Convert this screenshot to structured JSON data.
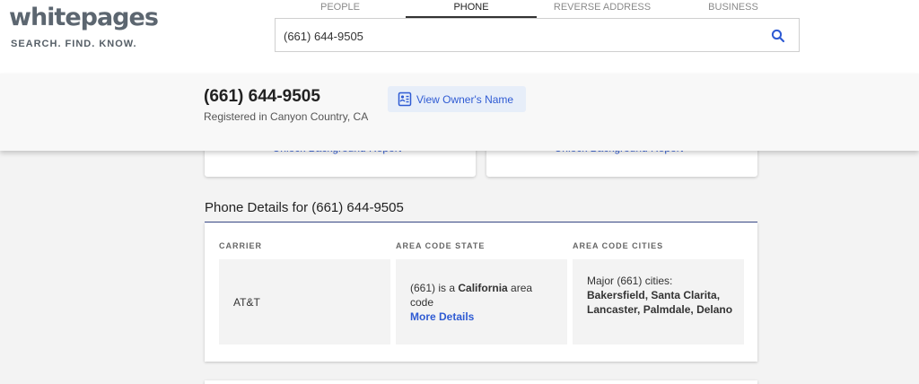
{
  "brand": {
    "name": "whitepages",
    "tagline": "SEARCH. FIND. KNOW."
  },
  "nav_tabs": [
    {
      "label": "PEOPLE",
      "active": false
    },
    {
      "label": "PHONE",
      "active": true
    },
    {
      "label": "REVERSE ADDRESS",
      "active": false
    },
    {
      "label": "BUSINESS",
      "active": false
    }
  ],
  "search": {
    "value": "(661) 644-9505",
    "icon": "search-icon"
  },
  "sticky": {
    "phone": "(661) 644-9505",
    "registered": "Registered in Canyon Country, CA",
    "owner_button": "View Owner's Name",
    "owner_icon": "contact-card-icon"
  },
  "cards": [
    {
      "link": "Unlock Background Report ›"
    },
    {
      "link": "Unlock Background Report ›"
    }
  ],
  "phone_details": {
    "title": "Phone Details for (661) 644-9505",
    "carrier_header": "CARRIER",
    "carrier_value": "AT&T",
    "state_header": "AREA CODE STATE",
    "state_prefix": "(661) is a ",
    "state_name": "California",
    "state_suffix": " area code",
    "more_details": "More Details",
    "cities_header": "AREA CODE CITIES",
    "cities_intro": "Major (661) cities:",
    "cities_list": "Bakersfield, Santa Clarita, Lancaster, Palmdale, Delano"
  },
  "colors": {
    "link": "#2f5bd3",
    "owner_button_bg": "#e7eef9",
    "section_rule": "#3a4a8a"
  }
}
